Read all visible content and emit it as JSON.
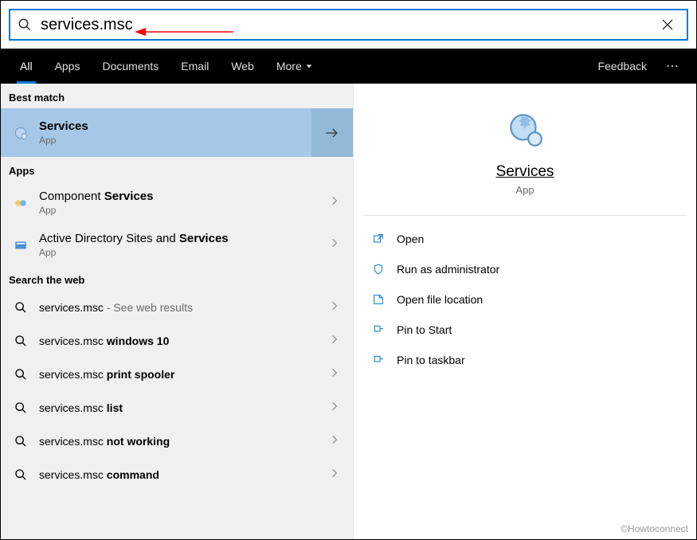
{
  "search": {
    "value": "services.msc",
    "placeholder": ""
  },
  "tabs": {
    "items": [
      "All",
      "Apps",
      "Documents",
      "Email",
      "Web",
      "More"
    ],
    "feedback": "Feedback"
  },
  "bestMatch": {
    "header": "Best match",
    "title": "Services",
    "sub": "App"
  },
  "apps": {
    "header": "Apps",
    "items": [
      {
        "prefix": "Component ",
        "bold": "Services",
        "sub": "App"
      },
      {
        "prefix": "Active Directory Sites and ",
        "bold": "Services",
        "sub": "App"
      }
    ]
  },
  "web": {
    "header": "Search the web",
    "items": [
      {
        "prefix": "services.msc",
        "bold": "",
        "suffix": " - See web results"
      },
      {
        "prefix": "services.msc ",
        "bold": "windows 10",
        "suffix": ""
      },
      {
        "prefix": "services.msc ",
        "bold": "print spooler",
        "suffix": ""
      },
      {
        "prefix": "services.msc ",
        "bold": "list",
        "suffix": ""
      },
      {
        "prefix": "services.msc ",
        "bold": "not working",
        "suffix": ""
      },
      {
        "prefix": "services.msc ",
        "bold": "command",
        "suffix": ""
      }
    ]
  },
  "preview": {
    "title": "Services",
    "sub": "App",
    "actions": [
      "Open",
      "Run as administrator",
      "Open file location",
      "Pin to Start",
      "Pin to taskbar"
    ]
  },
  "footer": "©Howtoconnect"
}
